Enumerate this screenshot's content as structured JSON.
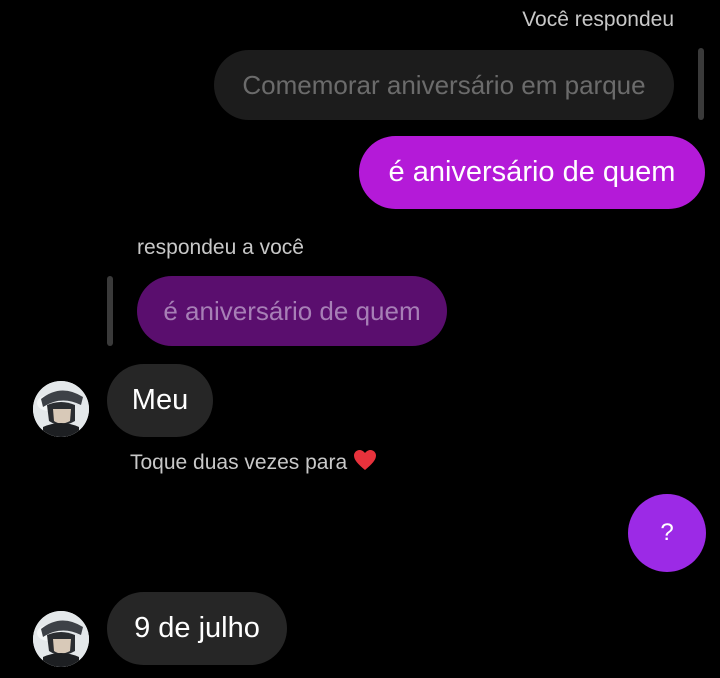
{
  "messages": {
    "sent_reply_label": "Você respondeu",
    "sent_reply_quote": "Comemorar aniversário em parque",
    "sent_message": "é aniversário de quem",
    "received_reply_label": "respondeu a você",
    "received_reply_quote": "é aniversário de quem",
    "received_message_1": "Meu",
    "double_tap_hint": "Toque duas vezes para",
    "sent_question": "?",
    "received_message_2": "9 de julho"
  },
  "icons": {
    "heart": "heart-icon",
    "avatar": "contact-avatar"
  },
  "colors": {
    "sent_bubble": "#b41ad8",
    "sent_circle": "#9c2ae6",
    "received_bubble": "#262626",
    "reply_quote_bg": "#1c1c1c",
    "reply_quote_purple_bg": "#5a0e6e",
    "heart": "#e8323c"
  }
}
